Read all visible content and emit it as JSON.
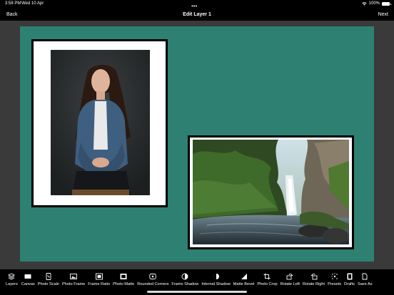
{
  "status_bar": {
    "time": "3:58 PM",
    "date": "Wed 10 Apr",
    "battery": "100%",
    "battery_level": 1.0
  },
  "nav": {
    "back_label": "Back",
    "title": "Edit Layer 1",
    "next_label": "Next",
    "multitask_dots": "•••"
  },
  "canvas": {
    "background_color": "#2e8073",
    "frame_color": "#000000",
    "matte_color": "#ffffff"
  },
  "toolbar": {
    "items": [
      {
        "label": "Layers",
        "icon": "layers-icon"
      },
      {
        "label": "Canvas",
        "icon": "canvas-icon"
      },
      {
        "label": "Photo Scale",
        "icon": "photo-scale-icon"
      },
      {
        "label": "Photo Frame",
        "icon": "photo-frame-icon"
      },
      {
        "label": "Frame Ratio",
        "icon": "frame-ratio-icon"
      },
      {
        "label": "Photo Matte",
        "icon": "photo-matte-icon"
      },
      {
        "label": "Rounded Corners",
        "icon": "rounded-corners-icon"
      },
      {
        "label": "Frame Shadow",
        "icon": "frame-shadow-icon"
      },
      {
        "label": "Internal Shadow",
        "icon": "internal-shadow-icon"
      },
      {
        "label": "Matte Bevel",
        "icon": "matte-bevel-icon"
      },
      {
        "label": "Photo Crop",
        "icon": "photo-crop-icon"
      },
      {
        "label": "Rotate Left",
        "icon": "rotate-left-icon"
      },
      {
        "label": "Rotate Right",
        "icon": "rotate-right-icon"
      },
      {
        "label": "Presets",
        "icon": "presets-icon"
      },
      {
        "label": "Drafts",
        "icon": "drafts-icon"
      },
      {
        "label": "Save As",
        "icon": "save-as-icon"
      }
    ]
  }
}
